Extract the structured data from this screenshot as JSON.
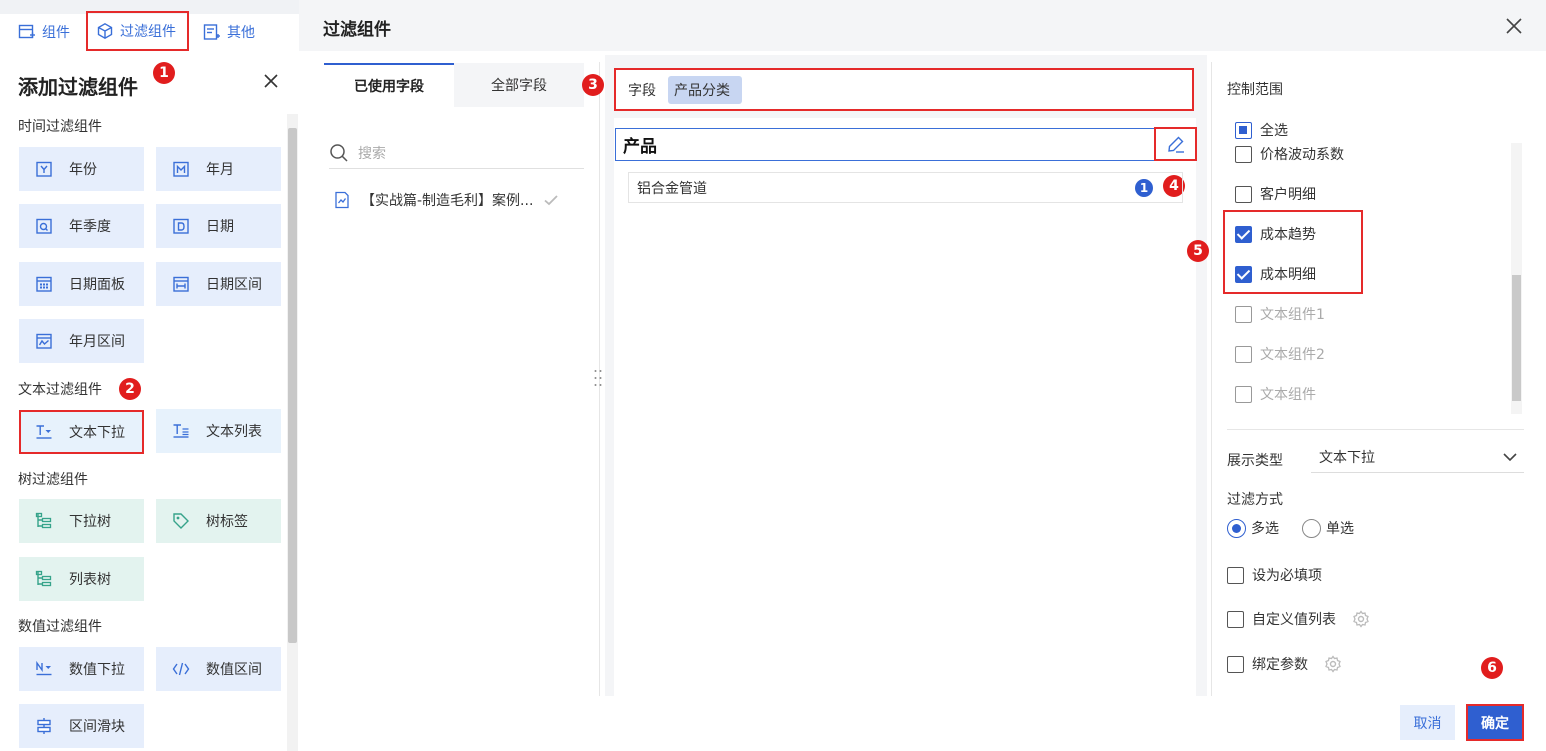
{
  "left_panel": {
    "tabs": [
      {
        "label": "组件"
      },
      {
        "label": "过滤组件"
      },
      {
        "label": "其他"
      }
    ],
    "title": "添加过滤组件",
    "sections": {
      "time": "时间过滤组件",
      "text": "文本过滤组件",
      "tree": "树过滤组件",
      "number": "数值过滤组件"
    },
    "time_items": [
      "年份",
      "年月",
      "年季度",
      "日期",
      "日期面板",
      "日期区间",
      "年月区间"
    ],
    "text_items": [
      "文本下拉",
      "文本列表"
    ],
    "tree_items": [
      "下拉树",
      "树标签",
      "列表树"
    ],
    "number_items": [
      "数值下拉",
      "数值区间",
      "区间滑块"
    ]
  },
  "badges": [
    "1",
    "2",
    "3",
    "4",
    "5",
    "6"
  ],
  "dialog": {
    "title": "过滤组件",
    "field_tabs": [
      "已使用字段",
      "全部字段"
    ],
    "search_placeholder": "搜索",
    "dataset_item": "【实战篇-制造毛利】案例...",
    "field_label": "字段",
    "field_chip": "产品分类",
    "product_header": "产品",
    "value_item": "铝合金管道",
    "value_count": "1",
    "control_range_label": "控制范围",
    "control_items": [
      {
        "label": "全选",
        "state": "partial"
      },
      {
        "label": "价格波动系数",
        "state": "off"
      },
      {
        "label": "客户明细",
        "state": "off"
      },
      {
        "label": "成本趋势",
        "state": "on"
      },
      {
        "label": "成本明细",
        "state": "on"
      },
      {
        "label": "文本组件1",
        "state": "disabled"
      },
      {
        "label": "文本组件2",
        "state": "disabled"
      },
      {
        "label": "文本组件",
        "state": "disabled"
      }
    ],
    "display_type_label": "展示类型",
    "display_type_value": "文本下拉",
    "filter_mode_label": "过滤方式",
    "filter_mode_options": [
      "多选",
      "单选"
    ],
    "filter_mode_selected": "多选",
    "required_label": "设为必填项",
    "custom_list_label": "自定义值列表",
    "bind_param_label": "绑定参数",
    "cancel_label": "取消",
    "ok_label": "确定"
  },
  "colors": {
    "accent": "#2f5fd0",
    "annotation_red": "#e11d1d",
    "tile_bg": "#e6eefc",
    "tree_tile_bg": "#e3f3ef"
  }
}
